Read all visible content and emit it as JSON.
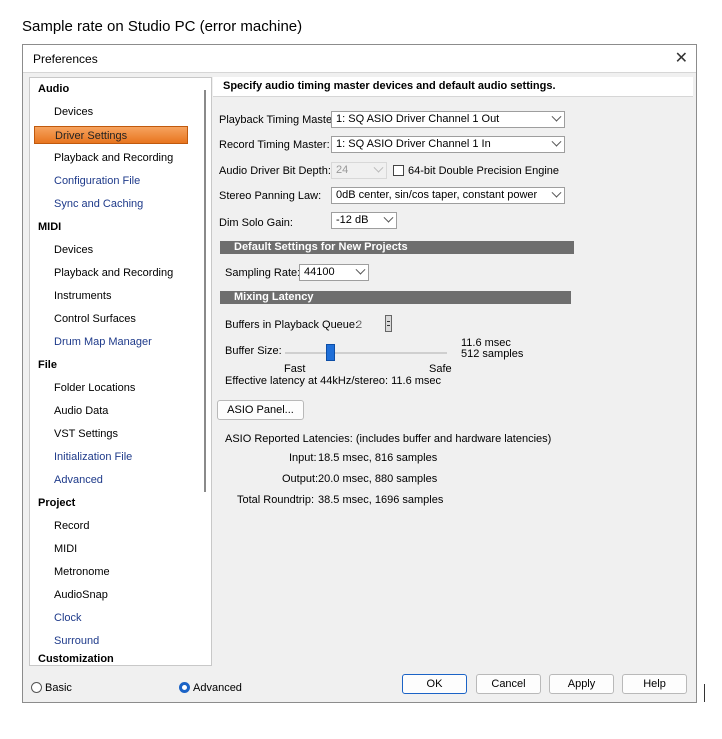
{
  "caption": "Sample rate on Studio PC (error machine)",
  "dialog": {
    "title": "Preferences",
    "close_symbol": "✕"
  },
  "sidebar": {
    "categories": {
      "audio": "Audio",
      "midi": "MIDI",
      "file": "File",
      "project": "Project",
      "customization": "Customization"
    },
    "audio_items": [
      "Devices",
      "Driver Settings",
      "Playback and Recording",
      "Configuration File",
      "Sync and Caching"
    ],
    "midi_items": [
      "Devices",
      "Playback and Recording",
      "Instruments",
      "Control Surfaces",
      "Drum Map Manager"
    ],
    "file_items": [
      "Folder Locations",
      "Audio Data",
      "VST Settings",
      "Initialization File",
      "Advanced"
    ],
    "project_items": [
      "Record",
      "MIDI",
      "Metronome",
      "AudioSnap",
      "Clock",
      "Surround"
    ],
    "selected": "Driver Settings"
  },
  "content": {
    "header": "Specify audio timing master devices and default audio settings.",
    "playback_timing_master": {
      "label": "Playback Timing Master:",
      "value": "1: SQ ASIO Driver Channel 1 Out"
    },
    "record_timing_master": {
      "label": "Record Timing Master:",
      "value": "1: SQ ASIO Driver Channel 1 In"
    },
    "bit_depth": {
      "label": "Audio Driver Bit Depth:",
      "value": "24",
      "double_precision_label": "64-bit Double Precision Engine",
      "double_precision_checked": false
    },
    "panning_law": {
      "label": "Stereo Panning Law:",
      "value": "0dB center, sin/cos taper, constant power"
    },
    "dim_solo_gain": {
      "label": "Dim Solo Gain:",
      "value": "-12 dB"
    },
    "default_settings_title": "Default Settings for New Projects",
    "sampling_rate": {
      "label": "Sampling Rate:",
      "value": "44100"
    },
    "mixing_latency_title": "Mixing Latency",
    "buffers_in_queue": {
      "label": "Buffers in Playback Queue:",
      "value": "2"
    },
    "buffer_size": {
      "label": "Buffer Size:",
      "fast_label": "Fast",
      "safe_label": "Safe",
      "msec": "11.6 msec",
      "samples": "512 samples",
      "slider_position": 0.27
    },
    "effective_latency": "Effective latency at 44kHz/stereo: 11.6 msec",
    "asio_panel_label": "ASIO Panel...",
    "reported_latencies_label": "ASIO Reported Latencies: (includes buffer and hardware latencies)",
    "input": {
      "label": "Input:",
      "value": "18.5 msec, 816 samples"
    },
    "output": {
      "label": "Output:",
      "value": "20.0 msec, 880 samples"
    },
    "roundtrip": {
      "label": "Total Roundtrip:",
      "value": "38.5 msec, 1696 samples"
    }
  },
  "footer": {
    "basic_label": "Basic",
    "advanced_label": "Advanced",
    "mode": "Advanced",
    "ok_label": "OK",
    "cancel_label": "Cancel",
    "apply_label": "Apply",
    "help_label": "Help"
  },
  "colors": {
    "selected_item": "#e8751f",
    "link_item": "#1e3a8a",
    "section_bar": "#6e6e6e",
    "slider_thumb": "#1f6fd8",
    "primary_button_border": "#1b63c6"
  }
}
